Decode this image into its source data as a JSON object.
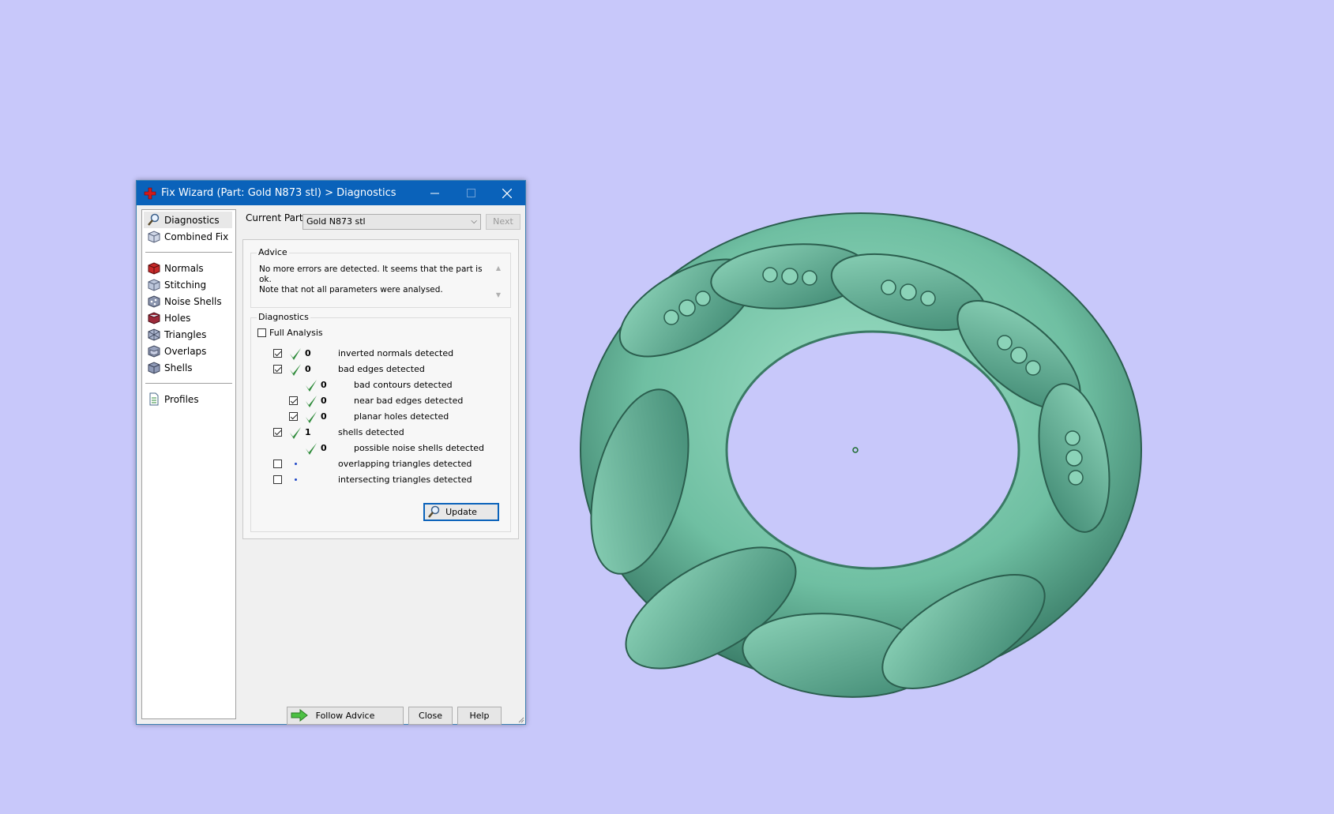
{
  "window": {
    "title": "Fix Wizard (Part: Gold N873 stl) > Diagnostics",
    "minimize_icon": "minimize-icon",
    "maximize_icon": "maximize-icon",
    "close_icon": "close-icon"
  },
  "sidebar": {
    "top_items": [
      {
        "label": "Diagnostics",
        "icon": "magnifier-icon",
        "selected": true
      },
      {
        "label": "Combined Fix",
        "icon": "cube-icon"
      }
    ],
    "fix_items": [
      {
        "label": "Normals",
        "icon": "normals-cube-icon"
      },
      {
        "label": "Stitching",
        "icon": "stitching-cube-icon"
      },
      {
        "label": "Noise Shells",
        "icon": "noise-shells-icon"
      },
      {
        "label": "Holes",
        "icon": "holes-cube-icon"
      },
      {
        "label": "Triangles",
        "icon": "triangles-cube-icon"
      },
      {
        "label": "Overlaps",
        "icon": "overlaps-cube-icon"
      },
      {
        "label": "Shells",
        "icon": "shells-cube-icon"
      }
    ],
    "bottom_items": [
      {
        "label": "Profiles",
        "icon": "document-icon"
      }
    ]
  },
  "current_part": {
    "label": "Current Part:",
    "value": "Gold N873 stl",
    "next_label": "Next"
  },
  "advice": {
    "title": "Advice",
    "line1": "No more errors are detected. It seems that the part is ok.",
    "line2": "Note that not all parameters were analysed."
  },
  "diagnostics": {
    "title": "Diagnostics",
    "full_analysis_label": "Full Analysis",
    "full_analysis_checked": false,
    "rows": [
      {
        "checkbox": true,
        "checked": true,
        "status": "ok",
        "count": "0",
        "label": "inverted normals detected",
        "indent": 0
      },
      {
        "checkbox": true,
        "checked": true,
        "status": "ok",
        "count": "0",
        "label": "bad edges detected",
        "indent": 0
      },
      {
        "checkbox": false,
        "checked": false,
        "status": "ok",
        "count": "0",
        "label": "bad contours detected",
        "indent": 1
      },
      {
        "checkbox": true,
        "checked": true,
        "status": "ok",
        "count": "0",
        "label": "near bad edges detected",
        "indent": 1
      },
      {
        "checkbox": true,
        "checked": true,
        "status": "ok",
        "count": "0",
        "label": "planar holes detected",
        "indent": 1
      },
      {
        "checkbox": true,
        "checked": true,
        "status": "ok",
        "count": "1",
        "label": "shells detected",
        "indent": 0
      },
      {
        "checkbox": false,
        "checked": false,
        "status": "ok",
        "count": "0",
        "label": "possible noise shells detected",
        "indent": 1
      },
      {
        "checkbox": true,
        "checked": false,
        "status": "not-analysed",
        "count": "",
        "label": "overlapping triangles detected",
        "indent": 0
      },
      {
        "checkbox": true,
        "checked": false,
        "status": "not-analysed",
        "count": "",
        "label": "intersecting triangles detected",
        "indent": 0
      }
    ],
    "update_label": "Update"
  },
  "buttons": {
    "follow_advice": "Follow Advice",
    "close": "Close",
    "help": "Help"
  },
  "colors": {
    "background": "#c8c8fa",
    "model": "#6fbfa2",
    "titlebar": "#0a62ba",
    "check_green": "#2e8b3a"
  }
}
